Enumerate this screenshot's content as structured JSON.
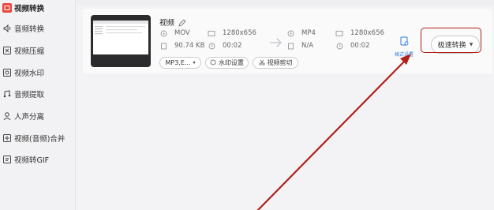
{
  "sidebar": {
    "items": [
      {
        "label": "视频转换",
        "icon": "video-convert-icon",
        "active": true
      },
      {
        "label": "音频转换",
        "icon": "audio-convert-icon",
        "active": false
      },
      {
        "label": "视频压缩",
        "icon": "video-compress-icon",
        "active": false
      },
      {
        "label": "视频水印",
        "icon": "video-watermark-icon",
        "active": false
      },
      {
        "label": "音频提取",
        "icon": "audio-extract-icon",
        "active": false
      },
      {
        "label": "人声分离",
        "icon": "voice-separate-icon",
        "active": false
      },
      {
        "label": "视频(音频)合并",
        "icon": "merge-icon",
        "active": false
      },
      {
        "label": "视频转GIF",
        "icon": "gif-icon",
        "active": false
      }
    ]
  },
  "file": {
    "name": "视频",
    "source": {
      "format": "MOV",
      "resolution": "1280x656",
      "size": "90.74 KB",
      "duration": "00:02"
    },
    "target": {
      "format": "MP4",
      "resolution": "1280x656",
      "size": "N/A",
      "duration": "00:02"
    },
    "format_select": "MP3,E...",
    "watermark_label": "水印设置",
    "cut_label": "视频剪切",
    "format_settings_label": "格式设置"
  },
  "convert_button": {
    "label": "极速转换"
  },
  "colors": {
    "accent": "#e8453c",
    "annotation": "#b0201a",
    "link": "#2d7be5"
  }
}
